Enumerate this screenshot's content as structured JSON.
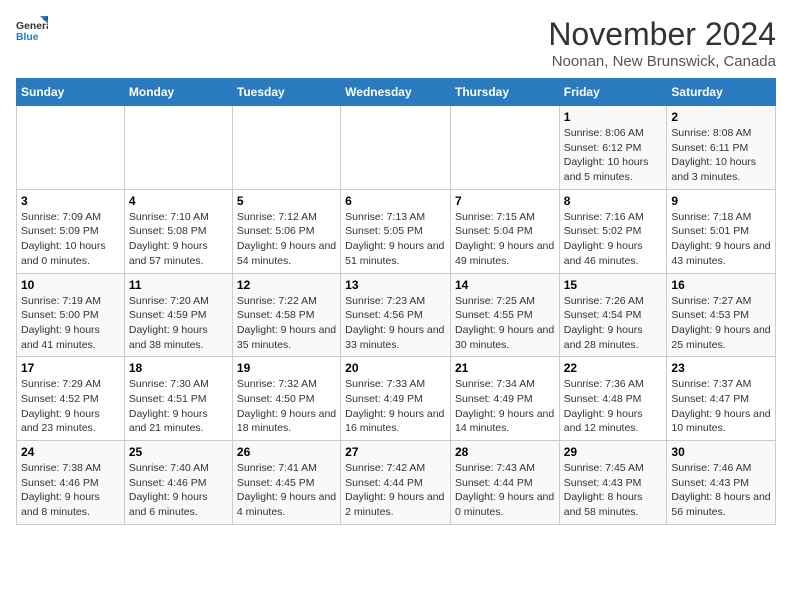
{
  "header": {
    "logo_general": "General",
    "logo_blue": "Blue",
    "month": "November 2024",
    "location": "Noonan, New Brunswick, Canada"
  },
  "weekdays": [
    "Sunday",
    "Monday",
    "Tuesday",
    "Wednesday",
    "Thursday",
    "Friday",
    "Saturday"
  ],
  "weeks": [
    [
      {
        "day": "",
        "info": ""
      },
      {
        "day": "",
        "info": ""
      },
      {
        "day": "",
        "info": ""
      },
      {
        "day": "",
        "info": ""
      },
      {
        "day": "",
        "info": ""
      },
      {
        "day": "1",
        "info": "Sunrise: 8:06 AM\nSunset: 6:12 PM\nDaylight: 10 hours and 5 minutes."
      },
      {
        "day": "2",
        "info": "Sunrise: 8:08 AM\nSunset: 6:11 PM\nDaylight: 10 hours and 3 minutes."
      }
    ],
    [
      {
        "day": "3",
        "info": "Sunrise: 7:09 AM\nSunset: 5:09 PM\nDaylight: 10 hours and 0 minutes."
      },
      {
        "day": "4",
        "info": "Sunrise: 7:10 AM\nSunset: 5:08 PM\nDaylight: 9 hours and 57 minutes."
      },
      {
        "day": "5",
        "info": "Sunrise: 7:12 AM\nSunset: 5:06 PM\nDaylight: 9 hours and 54 minutes."
      },
      {
        "day": "6",
        "info": "Sunrise: 7:13 AM\nSunset: 5:05 PM\nDaylight: 9 hours and 51 minutes."
      },
      {
        "day": "7",
        "info": "Sunrise: 7:15 AM\nSunset: 5:04 PM\nDaylight: 9 hours and 49 minutes."
      },
      {
        "day": "8",
        "info": "Sunrise: 7:16 AM\nSunset: 5:02 PM\nDaylight: 9 hours and 46 minutes."
      },
      {
        "day": "9",
        "info": "Sunrise: 7:18 AM\nSunset: 5:01 PM\nDaylight: 9 hours and 43 minutes."
      }
    ],
    [
      {
        "day": "10",
        "info": "Sunrise: 7:19 AM\nSunset: 5:00 PM\nDaylight: 9 hours and 41 minutes."
      },
      {
        "day": "11",
        "info": "Sunrise: 7:20 AM\nSunset: 4:59 PM\nDaylight: 9 hours and 38 minutes."
      },
      {
        "day": "12",
        "info": "Sunrise: 7:22 AM\nSunset: 4:58 PM\nDaylight: 9 hours and 35 minutes."
      },
      {
        "day": "13",
        "info": "Sunrise: 7:23 AM\nSunset: 4:56 PM\nDaylight: 9 hours and 33 minutes."
      },
      {
        "day": "14",
        "info": "Sunrise: 7:25 AM\nSunset: 4:55 PM\nDaylight: 9 hours and 30 minutes."
      },
      {
        "day": "15",
        "info": "Sunrise: 7:26 AM\nSunset: 4:54 PM\nDaylight: 9 hours and 28 minutes."
      },
      {
        "day": "16",
        "info": "Sunrise: 7:27 AM\nSunset: 4:53 PM\nDaylight: 9 hours and 25 minutes."
      }
    ],
    [
      {
        "day": "17",
        "info": "Sunrise: 7:29 AM\nSunset: 4:52 PM\nDaylight: 9 hours and 23 minutes."
      },
      {
        "day": "18",
        "info": "Sunrise: 7:30 AM\nSunset: 4:51 PM\nDaylight: 9 hours and 21 minutes."
      },
      {
        "day": "19",
        "info": "Sunrise: 7:32 AM\nSunset: 4:50 PM\nDaylight: 9 hours and 18 minutes."
      },
      {
        "day": "20",
        "info": "Sunrise: 7:33 AM\nSunset: 4:49 PM\nDaylight: 9 hours and 16 minutes."
      },
      {
        "day": "21",
        "info": "Sunrise: 7:34 AM\nSunset: 4:49 PM\nDaylight: 9 hours and 14 minutes."
      },
      {
        "day": "22",
        "info": "Sunrise: 7:36 AM\nSunset: 4:48 PM\nDaylight: 9 hours and 12 minutes."
      },
      {
        "day": "23",
        "info": "Sunrise: 7:37 AM\nSunset: 4:47 PM\nDaylight: 9 hours and 10 minutes."
      }
    ],
    [
      {
        "day": "24",
        "info": "Sunrise: 7:38 AM\nSunset: 4:46 PM\nDaylight: 9 hours and 8 minutes."
      },
      {
        "day": "25",
        "info": "Sunrise: 7:40 AM\nSunset: 4:46 PM\nDaylight: 9 hours and 6 minutes."
      },
      {
        "day": "26",
        "info": "Sunrise: 7:41 AM\nSunset: 4:45 PM\nDaylight: 9 hours and 4 minutes."
      },
      {
        "day": "27",
        "info": "Sunrise: 7:42 AM\nSunset: 4:44 PM\nDaylight: 9 hours and 2 minutes."
      },
      {
        "day": "28",
        "info": "Sunrise: 7:43 AM\nSunset: 4:44 PM\nDaylight: 9 hours and 0 minutes."
      },
      {
        "day": "29",
        "info": "Sunrise: 7:45 AM\nSunset: 4:43 PM\nDaylight: 8 hours and 58 minutes."
      },
      {
        "day": "30",
        "info": "Sunrise: 7:46 AM\nSunset: 4:43 PM\nDaylight: 8 hours and 56 minutes."
      }
    ]
  ]
}
